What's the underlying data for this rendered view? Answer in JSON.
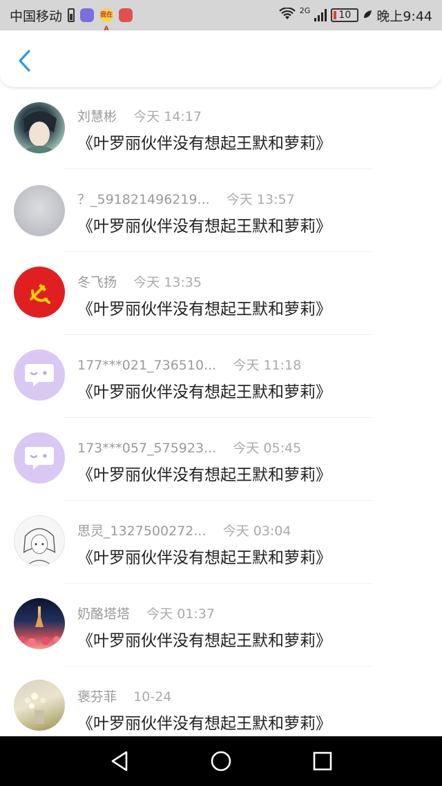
{
  "status_bar": {
    "carrier": "中国移动",
    "app_badge_text": "我在A",
    "network": "2G",
    "battery": "10",
    "time": "晚上9:44"
  },
  "header": {
    "back_icon": "chevron-left-icon",
    "accent_color": "#2f96f0"
  },
  "comments": [
    {
      "user": "刘慧彬",
      "time": "今天 14:17",
      "content": "《叶罗丽伙伴没有想起王默和萝莉》",
      "avatar": "anime-boy-avatar"
    },
    {
      "user": "？_591821496219...",
      "time": "今天 13:57",
      "content": "《叶罗丽伙伴没有想起王默和萝莉》",
      "avatar": "gray-sky-avatar"
    },
    {
      "user": "冬飞扬",
      "time": "今天 13:35",
      "content": "《叶罗丽伙伴没有想起王默和萝莉》",
      "avatar": "red-emblem-avatar"
    },
    {
      "user": "177***021_736510...",
      "time": "今天 11:18",
      "content": "《叶罗丽伙伴没有想起王默和萝莉》",
      "avatar": "default-purple-avatar"
    },
    {
      "user": "173***057_575923...",
      "time": "今天 05:45",
      "content": "《叶罗丽伙伴没有想起王默和萝莉》",
      "avatar": "default-purple-avatar"
    },
    {
      "user": "思灵_1327500272...",
      "time": "今天 03:04",
      "content": "《叶罗丽伙伴没有想起王默和萝莉》",
      "avatar": "sketch-girl-avatar"
    },
    {
      "user": "奶酪塔塔",
      "time": "今天 01:37",
      "content": "《叶罗丽伙伴没有想起王默和萝莉》",
      "avatar": "night-flowers-avatar"
    },
    {
      "user": "褒芬菲",
      "time": "10-24",
      "content": "《叶罗丽伙伴没有想起王默和萝莉》",
      "avatar": "flower-vase-avatar"
    }
  ],
  "nav_bar": {
    "back": "triangle-back-icon",
    "home": "circle-home-icon",
    "recents": "square-recents-icon"
  }
}
